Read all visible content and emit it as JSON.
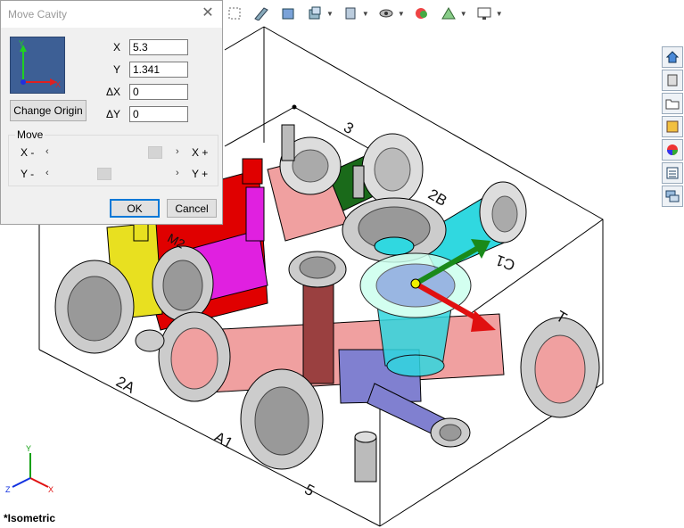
{
  "dialog": {
    "title": "Move Cavity",
    "close_icon": "close-icon",
    "triad_icon": "axis-triad-icon",
    "fields": [
      {
        "label": "X",
        "value": "5.3"
      },
      {
        "label": "Y",
        "value": "1.341"
      },
      {
        "label": "ΔX",
        "value": "0"
      },
      {
        "label": "ΔY",
        "value": "0"
      }
    ],
    "change_origin_label": "Change Origin",
    "move_group_label": "Move",
    "sliders": [
      {
        "minus_label": "X -",
        "plus_label": "X +",
        "level": 0.9
      },
      {
        "minus_label": "Y -",
        "plus_label": "Y +",
        "level": 0.4
      }
    ],
    "ok_label": "OK",
    "cancel_label": "Cancel"
  },
  "toolbar": {
    "icons": [
      "zoom-to-fit-icon",
      "section-view-icon",
      "view-orientation-icon",
      "display-style-icon",
      "hide-show-items-icon",
      "edit-appearance-icon",
      "apply-scene-icon",
      "view-settings-icon"
    ]
  },
  "taskpane": {
    "icons": [
      "home-icon",
      "design-library-icon",
      "file-explorer-icon",
      "view-palette-icon",
      "appearances-icon",
      "custom-properties-icon",
      "forum-icon"
    ]
  },
  "model": {
    "port_labels": [
      "3",
      "2B",
      "C1",
      "T",
      "M2",
      "2A",
      "A1",
      "5"
    ]
  },
  "view": {
    "orientation_label": "*Isometric"
  },
  "colors": {
    "manifold_edge": "#000000",
    "red_passage": "#e00000",
    "pink_passage": "#f0a0a0",
    "yellow_passage": "#e8e020",
    "magenta_passage": "#e020e0",
    "green_passage": "#1a6a1a",
    "cyan_cavity": "#30d8e0",
    "blue_passage": "#8080d0",
    "dark_red_passage": "#9a4040",
    "triad_x": "#e01010",
    "triad_y": "#10c010"
  }
}
